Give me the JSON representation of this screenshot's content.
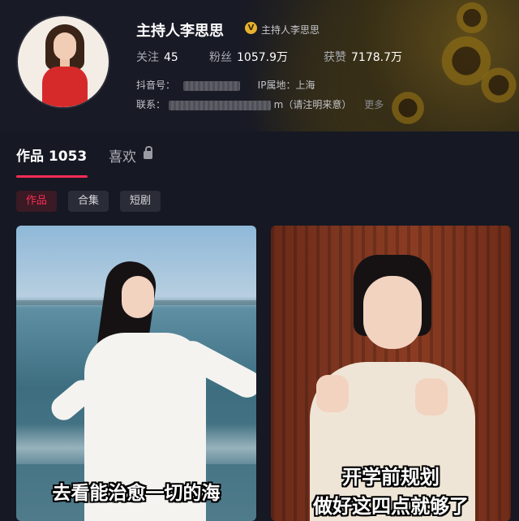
{
  "profile": {
    "name": "主持人李思思",
    "verified_icon": "verified-badge-icon",
    "verified_text": "主持人李思思",
    "stats": [
      {
        "label": "关注",
        "value": "45"
      },
      {
        "label": "粉丝",
        "value": "1057.9万"
      },
      {
        "label": "获赞",
        "value": "7178.7万"
      }
    ],
    "douyin_id_label": "抖音号：",
    "ip_label": "IP属地：上海",
    "contact_label": "联系：",
    "contact_suffix": "m（请注明来意）",
    "more_label": "更多"
  },
  "tabs": {
    "works_label": "作品 1053",
    "likes_label": "喜欢",
    "likes_icon": "lock-icon"
  },
  "chips": [
    "作品",
    "合集",
    "短剧"
  ],
  "videos": [
    {
      "caption": "去看能治愈一切的海"
    },
    {
      "caption_line1": "开学前规划",
      "caption_line2": "做好这四点就够了"
    }
  ],
  "colors": {
    "background": "#161823",
    "accent": "#fe2c55",
    "verified": "#e9b22d"
  }
}
